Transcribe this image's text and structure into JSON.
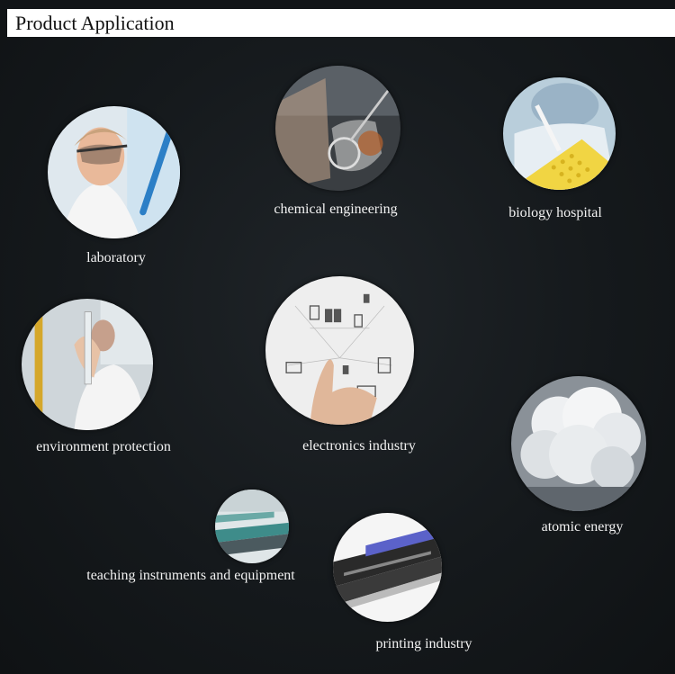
{
  "header": {
    "title": "Product Application"
  },
  "applications": [
    {
      "label": "laboratory",
      "icon": "scientist-icon"
    },
    {
      "label": "chemical engineering",
      "icon": "flask-icon"
    },
    {
      "label": "biology hospital",
      "icon": "pipette-plate-icon"
    },
    {
      "label": "environment protection",
      "icon": "test-tube-icon"
    },
    {
      "label": "electronics industry",
      "icon": "devices-network-icon"
    },
    {
      "label": "atomic energy",
      "icon": "cloud-icon"
    },
    {
      "label": "teaching instruments and equipment",
      "icon": "lab-bench-icon"
    },
    {
      "label": "printing industry",
      "icon": "printer-icon"
    }
  ]
}
